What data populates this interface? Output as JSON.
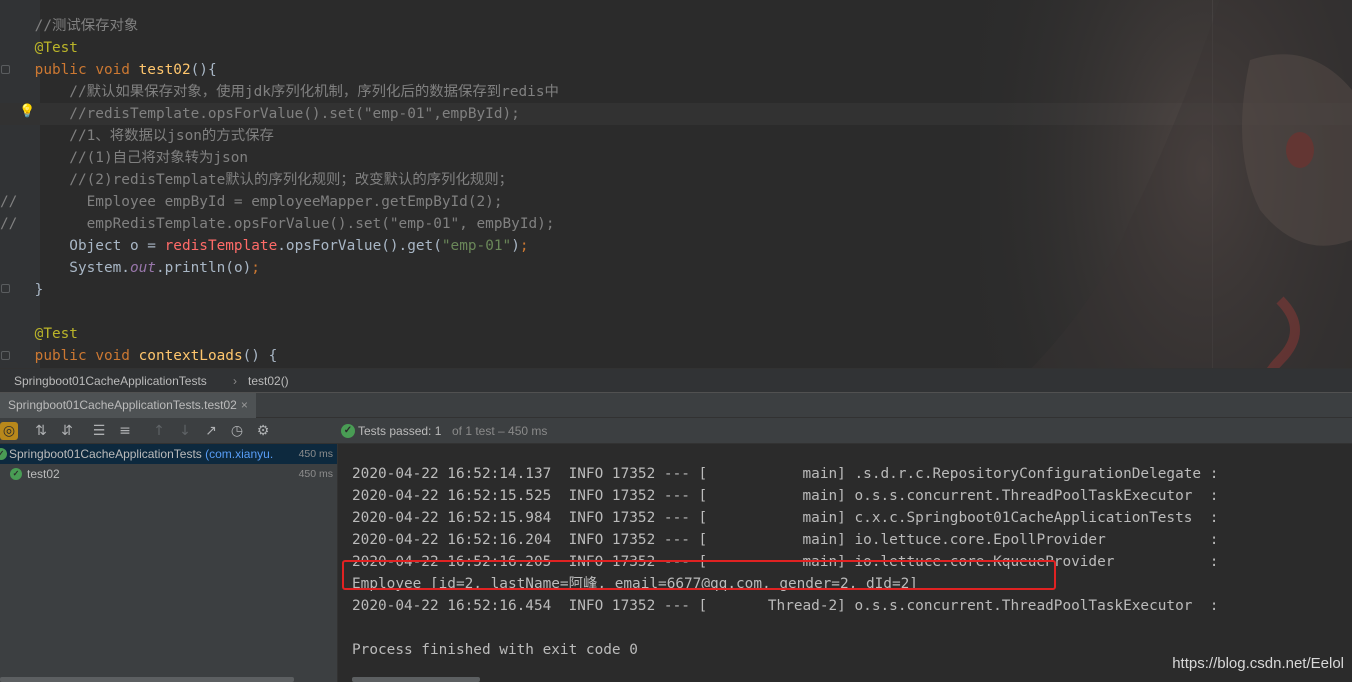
{
  "editor": {
    "lines": [
      [
        {
          "t": "    //测试保存对象",
          "c": "c-com"
        }
      ],
      [
        {
          "t": "    @Test",
          "c": "c-ann"
        }
      ],
      [
        {
          "t": "    public ",
          "c": "c-kw"
        },
        {
          "t": "void ",
          "c": "c-kw"
        },
        {
          "t": "test02",
          "c": "c-fn"
        },
        {
          "t": "(){",
          "c": "c-plain"
        }
      ],
      [
        {
          "t": "        //默认如果保存对象，使用jdk序列化机制，序列化后的数据保存到redis中",
          "c": "c-com"
        }
      ],
      [
        {
          "t": "        //redisTemplate.opsForValue().set(\"emp-01\",empById);",
          "c": "c-com"
        }
      ],
      [
        {
          "t": "        //1、将数据以json的方式保存",
          "c": "c-com"
        }
      ],
      [
        {
          "t": "        //(1)自己将对象转为json",
          "c": "c-com"
        }
      ],
      [
        {
          "t": "        //(2)redisTemplate默认的序列化规则；改变默认的序列化规则；",
          "c": "c-com"
        }
      ],
      [
        {
          "t": "//        Employee empById = employeeMapper.getEmpById(2);",
          "c": "c-com"
        }
      ],
      [
        {
          "t": "//        empRedisTemplate.opsForValue().set(\"emp-01\", empById);",
          "c": "c-com"
        }
      ],
      [
        {
          "t": "        Object o = ",
          "c": "c-plain"
        },
        {
          "t": "redisTemplate",
          "c": "c-red"
        },
        {
          "t": ".opsForValue().get(",
          "c": "c-plain"
        },
        {
          "t": "\"emp-01\"",
          "c": "c-str"
        },
        {
          "t": ")",
          "c": "c-plain"
        },
        {
          "t": ";",
          "c": "c-kw"
        }
      ],
      [
        {
          "t": "        System.",
          "c": "c-plain"
        },
        {
          "t": "out",
          "c": "c-fld"
        },
        {
          "t": ".println(o)",
          "c": "c-plain"
        },
        {
          "t": ";",
          "c": "c-kw"
        }
      ],
      [
        {
          "t": "    }",
          "c": "c-plain"
        }
      ],
      [
        {
          "t": "",
          "c": "c-plain"
        }
      ],
      [
        {
          "t": "    @Test",
          "c": "c-ann"
        }
      ],
      [
        {
          "t": "    public ",
          "c": "c-kw"
        },
        {
          "t": "void ",
          "c": "c-kw"
        },
        {
          "t": "contextLoads",
          "c": "c-fn"
        },
        {
          "t": "() {",
          "c": "c-plain"
        }
      ]
    ],
    "current_line_index": 4
  },
  "breadcrumb": {
    "class_name": "Springboot01CacheApplicationTests",
    "separator": "›",
    "method_name": "test02()"
  },
  "run": {
    "tab_label": "Springboot01CacheApplicationTests.test02",
    "tab_close": "×",
    "status": {
      "passed_label": "Tests passed:",
      "passed_count": "1",
      "rest": "of 1 test – 450 ms"
    },
    "tree": [
      {
        "name": "Springboot01CacheApplicationTests",
        "pkg": "(com.xianyu.",
        "time": "450 ms"
      },
      {
        "name": "test02",
        "pkg": "",
        "time": "450 ms"
      }
    ],
    "console": [
      "2020-04-22 16:52:14.137  INFO 17352 --- [           main] .s.d.r.c.RepositoryConfigurationDelegate :",
      "2020-04-22 16:52:15.525  INFO 17352 --- [           main] o.s.s.concurrent.ThreadPoolTaskExecutor  :",
      "2020-04-22 16:52:15.984  INFO 17352 --- [           main] c.x.c.Springboot01CacheApplicationTests  :",
      "2020-04-22 16:52:16.204  INFO 17352 --- [           main] io.lettuce.core.EpollProvider            :",
      "2020-04-22 16:52:16.205  INFO 17352 --- [           main] io.lettuce.core.KqueueProvider           :",
      "Employee [id=2, lastName=阿峰, email=6677@qq.com, gender=2, dId=2]",
      "2020-04-22 16:52:16.454  INFO 17352 --- [       Thread-2] o.s.s.concurrent.ThreadPoolTaskExecutor  :",
      "",
      "Process finished with exit code 0"
    ],
    "watermark": "https://blog.csdn.net/Eelol"
  },
  "colors": {
    "passed": "#499c54",
    "highlight_box": "#e02222",
    "toggle_active": "#b9881b"
  }
}
